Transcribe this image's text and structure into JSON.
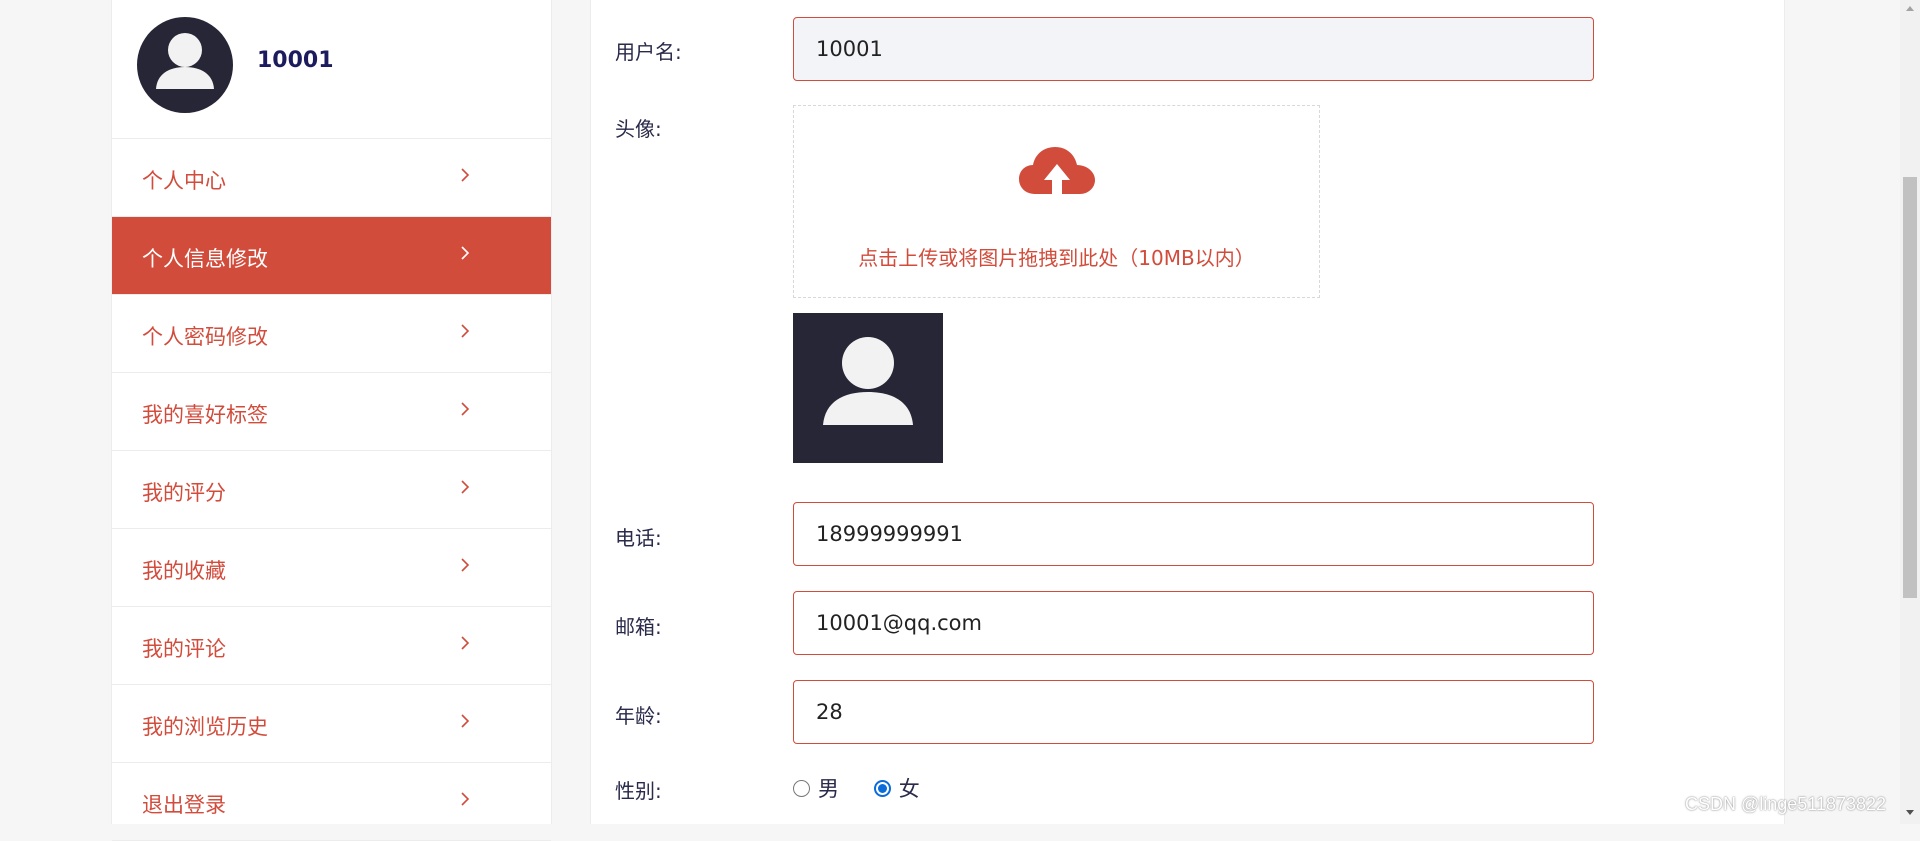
{
  "sidebar": {
    "username": "10001",
    "items": [
      {
        "label": "个人中心"
      },
      {
        "label": "个人信息修改"
      },
      {
        "label": "个人密码修改"
      },
      {
        "label": "我的喜好标签"
      },
      {
        "label": "我的评分"
      },
      {
        "label": "我的收藏"
      },
      {
        "label": "我的评论"
      },
      {
        "label": "我的浏览历史"
      },
      {
        "label": "退出登录"
      }
    ],
    "active_item": "个人信息修改"
  },
  "form": {
    "username": {
      "label": "用户名:",
      "value": "10001"
    },
    "avatar": {
      "label": "头像:",
      "upload_hint": "点击上传或将图片拖拽到此处（10MB以内）"
    },
    "phone": {
      "label": "电话:",
      "value": "18999999991"
    },
    "email": {
      "label": "邮箱:",
      "value": "10001@qq.com"
    },
    "age": {
      "label": "年龄:",
      "value": "28"
    },
    "gender": {
      "label": "性别:",
      "options": [
        "男",
        "女"
      ],
      "selected": "女"
    }
  },
  "watermark": "CSDN @linge511873822",
  "colors": {
    "accent": "#d24c3c",
    "avatar_bg": "#262636",
    "radio_checked": "#0b6bda"
  }
}
